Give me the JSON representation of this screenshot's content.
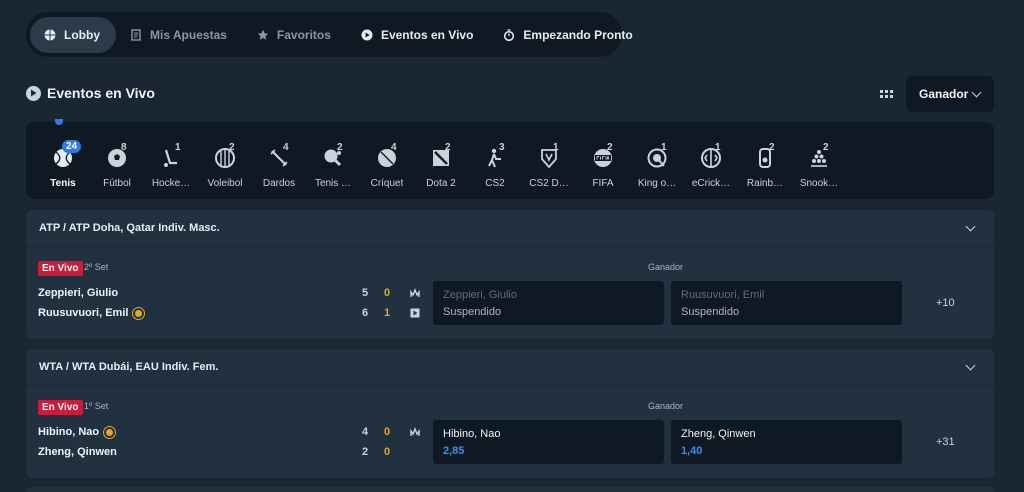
{
  "nav": {
    "items": [
      {
        "label": "Lobby",
        "icon": "basketball-icon",
        "active": true
      },
      {
        "label": "Mis Apuestas",
        "icon": "ticket-icon"
      },
      {
        "label": "Favoritos",
        "icon": "star-icon"
      },
      {
        "label": "Eventos en Vivo",
        "icon": "play-icon"
      },
      {
        "label": "Empezando Pronto",
        "icon": "stopwatch-icon"
      }
    ]
  },
  "section": {
    "title": "Eventos en Vivo",
    "market_select": "Ganador"
  },
  "sports": [
    {
      "label": "Tenis",
      "count": "24",
      "icon": "tennis-ball-icon"
    },
    {
      "label": "Fútbol",
      "count": "8",
      "icon": "soccer-ball-icon"
    },
    {
      "label": "Hocke…",
      "count": "1",
      "icon": "hockey-stick-icon"
    },
    {
      "label": "Voleibol",
      "count": "2",
      "icon": "volleyball-icon"
    },
    {
      "label": "Dardos",
      "count": "4",
      "icon": "dart-icon"
    },
    {
      "label": "Tenis …",
      "count": "2",
      "icon": "table-tennis-icon"
    },
    {
      "label": "Críquet",
      "count": "4",
      "icon": "cricket-ball-icon"
    },
    {
      "label": "Dota 2",
      "count": "2",
      "icon": "dota2-icon"
    },
    {
      "label": "CS2",
      "count": "3",
      "icon": "cs2-soldier-icon"
    },
    {
      "label": "CS2 D…",
      "count": "1",
      "icon": "cs2-duels-icon"
    },
    {
      "label": "FIFA",
      "count": "2",
      "icon": "fifa-icon"
    },
    {
      "label": "King o…",
      "count": "1",
      "icon": "king-of-glory-icon"
    },
    {
      "label": "eCrick…",
      "count": "1",
      "icon": "ecricket-icon"
    },
    {
      "label": "Rainb…",
      "count": "2",
      "icon": "rainbow-six-icon"
    },
    {
      "label": "Snook…",
      "count": "2",
      "icon": "snooker-icon"
    }
  ],
  "events": [
    {
      "league": "ATP / ATP Doha, Qatar Indiv. Masc.",
      "live": "En Vivo",
      "set": "2º Set",
      "market": "Ganador",
      "players": [
        {
          "name": "Zeppieri, Giulio",
          "sets": "5",
          "games": "0",
          "server": false
        },
        {
          "name": "Ruusuvuori, Emil",
          "sets": "6",
          "games": "1",
          "server": true
        }
      ],
      "odds": [
        {
          "name": "Zeppieri, Giulio",
          "value": "Suspendido",
          "suspended": true
        },
        {
          "name": "Ruusuvuori, Emil",
          "value": "Suspendido",
          "suspended": true
        }
      ],
      "more": "+10"
    },
    {
      "league": "WTA / WTA Dubái, EAU Indiv. Fem.",
      "live": "En Vivo",
      "set": "1º Set",
      "market": "Ganador",
      "players": [
        {
          "name": "Hibino, Nao",
          "sets": "4",
          "games": "0",
          "server": true
        },
        {
          "name": "Zheng, Qinwen",
          "sets": "2",
          "games": "0",
          "server": false
        }
      ],
      "odds": [
        {
          "name": "Hibino, Nao",
          "value": "2,85",
          "suspended": false
        },
        {
          "name": "Zheng, Qinwen",
          "value": "1,40",
          "suspended": false
        }
      ],
      "more": "+31"
    }
  ],
  "colors": {
    "live": "#c81e3c",
    "odds": "#3b8df5",
    "server": "#e5a81e",
    "accent": "#2f7be6"
  }
}
